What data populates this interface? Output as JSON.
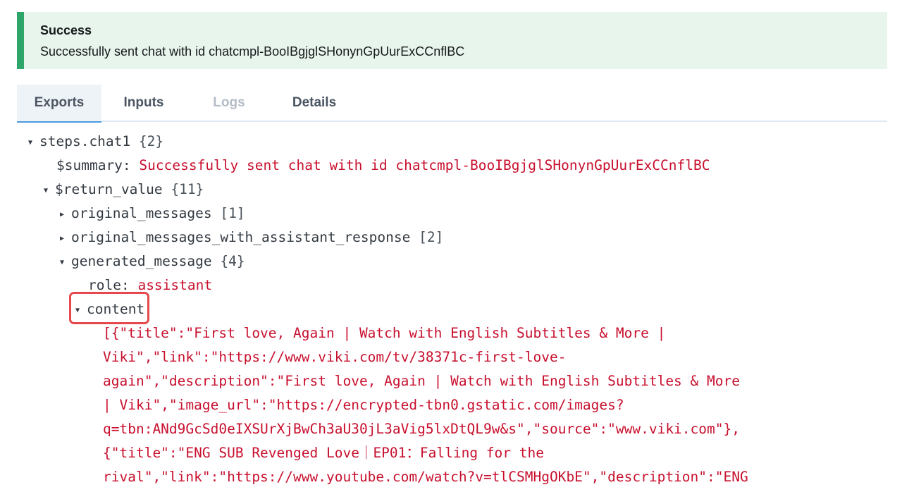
{
  "alert": {
    "title": "Success",
    "message": "Successfully sent chat with id chatcmpl-BooIBgjglSHonynGpUurExCCnflBC",
    "accent": "#2ea66a"
  },
  "tabs": [
    {
      "label": "Exports",
      "state": "active"
    },
    {
      "label": "Inputs",
      "state": "normal"
    },
    {
      "label": "Logs",
      "state": "disabled"
    },
    {
      "label": "Details",
      "state": "normal"
    }
  ],
  "tree": {
    "root": {
      "key": "steps.chat1",
      "count": "{2}"
    },
    "summary": {
      "key": "$summary:",
      "value": "Successfully sent chat with id chatcmpl-BooIBgjglSHonynGpUurExCCnflBC"
    },
    "return_value": {
      "key": "$return_value",
      "count": "{11}"
    },
    "original_messages": {
      "key": "original_messages",
      "count": "[1]"
    },
    "original_messages_with_assistant_response": {
      "key": "original_messages_with_assistant_response",
      "count": "[2]"
    },
    "generated_message": {
      "key": "generated_message",
      "count": "{4}"
    },
    "role": {
      "key": "role:",
      "value": "assistant"
    },
    "content": {
      "key": "content"
    },
    "content_lines": [
      "[{\"title\":\"First love, Again | Watch with English Subtitles & More |",
      "Viki\",\"link\":\"https://www.viki.com/tv/38371c-first-love-",
      "again\",\"description\":\"First love, Again | Watch with English Subtitles & More",
      "| Viki\",\"image_url\":\"https://encrypted-tbn0.gstatic.com/images?",
      "q=tbn:ANd9GcSd0eIXSUrXjBwCh3aU30jL3aVig5lxDtQL9w&s\",\"source\":\"www.viki.com\"},",
      "{\"title\":\"ENG SUB Revenged Love｜EP01：Falling for the",
      "rival\",\"link\":\"https://www.youtube.com/watch?v=tlCSMHgOKbE\",\"description\":\"ENG"
    ]
  }
}
